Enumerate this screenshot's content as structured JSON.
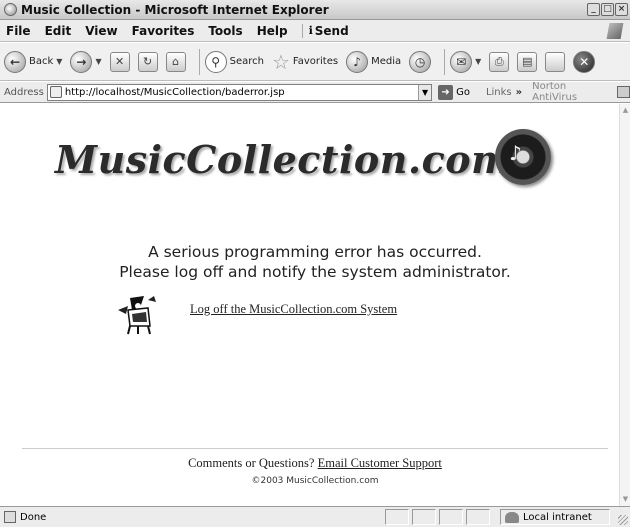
{
  "window": {
    "title": "Music Collection - Microsoft Internet Explorer",
    "controls": [
      "_",
      "□",
      "×"
    ]
  },
  "menu": {
    "items": [
      "File",
      "Edit",
      "View",
      "Favorites",
      "Tools",
      "Help"
    ],
    "send_label": "Send"
  },
  "toolbar": {
    "back_label": "Back",
    "search_label": "Search",
    "favorites_label": "Favorites",
    "media_label": "Media"
  },
  "address": {
    "label": "Address",
    "url": "http://localhost/MusicCollection/baderror.jsp",
    "go_label": "Go",
    "links_label": "Links",
    "norton_label": "Norton AntiVirus"
  },
  "page": {
    "logo_text": "MusicCollection.com",
    "error_line1": "A serious programming error has occurred.",
    "error_line2": "Please log off and notify the system administrator.",
    "logoff_link": "Log off the MusicCollection.com System",
    "footer_prefix": "Comments or Questions? ",
    "footer_link": "Email Customer Support",
    "copyright": "©2003 MusicCollection.com"
  },
  "status": {
    "text": "Done",
    "zone": "Local intranet"
  }
}
